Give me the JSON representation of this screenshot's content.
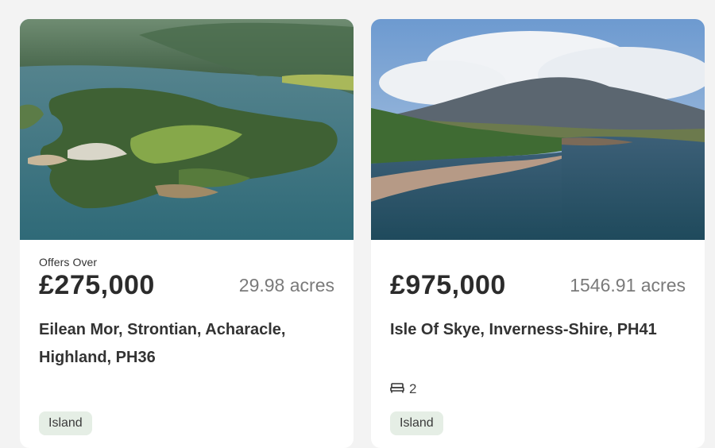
{
  "listings": [
    {
      "offers_label": "Offers Over",
      "price": "£275,000",
      "acres": "29.98 acres",
      "address": "Eilean Mor, Strontian, Acharacle, Highland, PH36",
      "tag": "Island",
      "image_icon": "aerial-island-photo"
    },
    {
      "price": "£975,000",
      "acres": "1546.91 acres",
      "address": "Isle Of Skye, Inverness-Shire, PH41",
      "bedrooms": "2",
      "bed_icon": "bed-icon",
      "tag": "Island",
      "image_icon": "coast-mountain-photo"
    }
  ]
}
